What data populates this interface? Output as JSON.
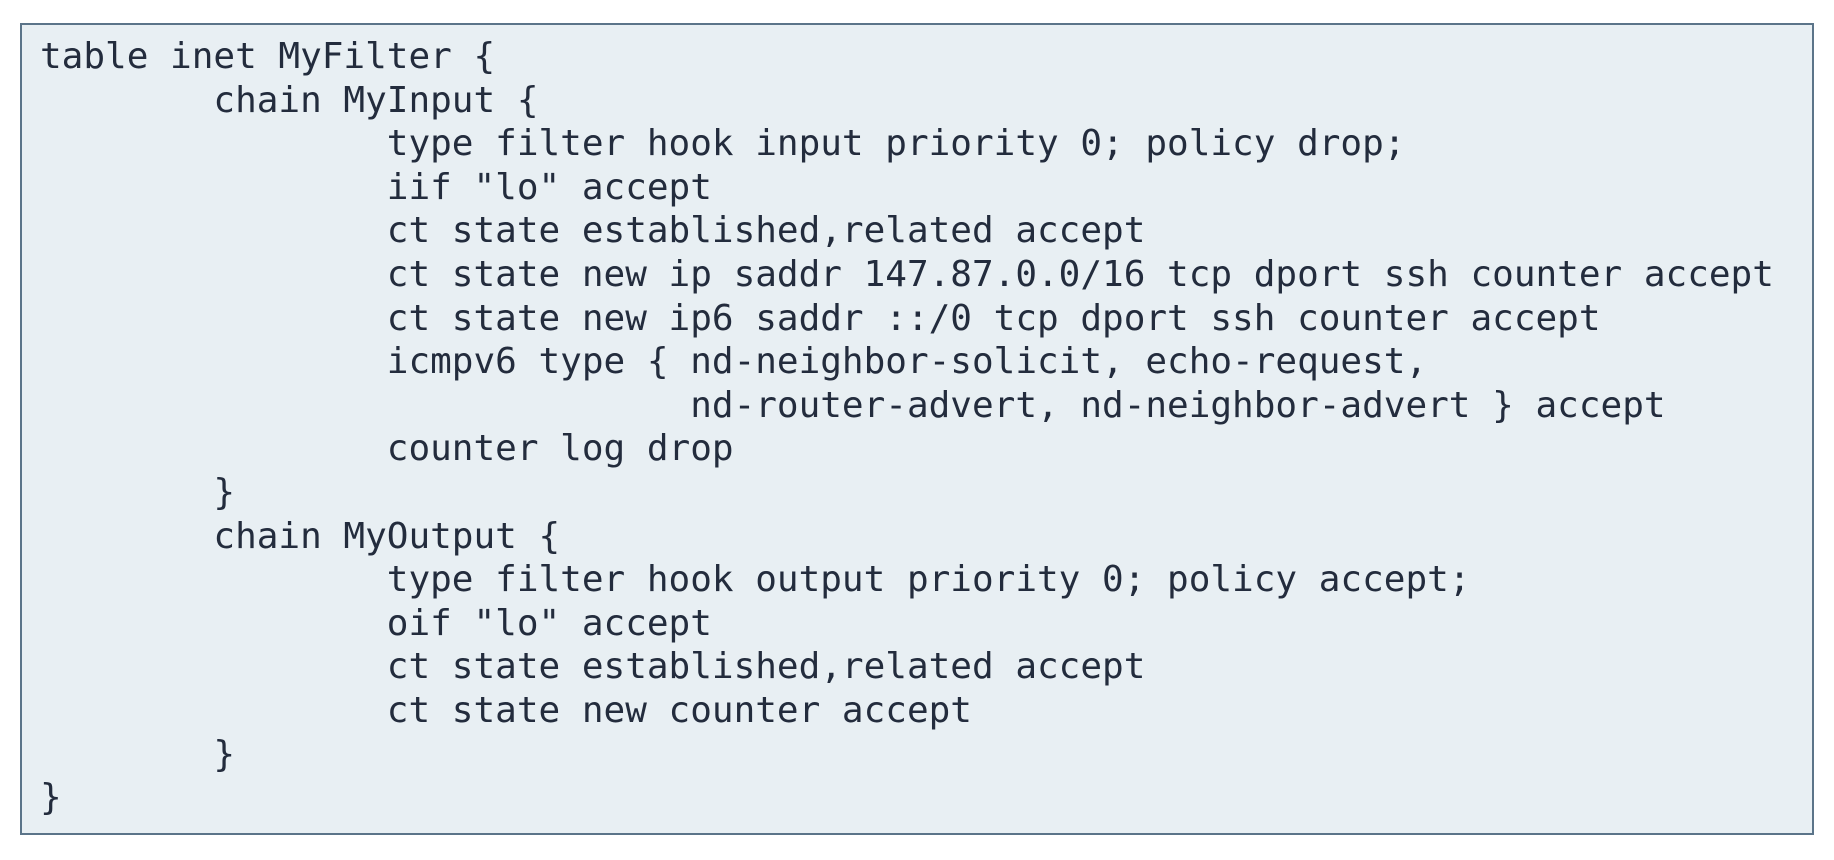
{
  "code": {
    "lines": [
      "table inet MyFilter {",
      "        chain MyInput {",
      "                type filter hook input priority 0; policy drop;",
      "                iif \"lo\" accept",
      "                ct state established,related accept",
      "                ct state new ip saddr 147.87.0.0/16 tcp dport ssh counter accept",
      "                ct state new ip6 saddr ::/0 tcp dport ssh counter accept",
      "                icmpv6 type { nd-neighbor-solicit, echo-request,",
      "                              nd-router-advert, nd-neighbor-advert } accept",
      "                counter log drop",
      "        }",
      "        chain MyOutput {",
      "                type filter hook output priority 0; policy accept;",
      "                oif \"lo\" accept",
      "                ct state established,related accept",
      "                ct state new counter accept",
      "        }",
      "}"
    ]
  },
  "colors": {
    "background": "#e8eff3",
    "border": "#5b7489",
    "text": "#232c3d"
  }
}
